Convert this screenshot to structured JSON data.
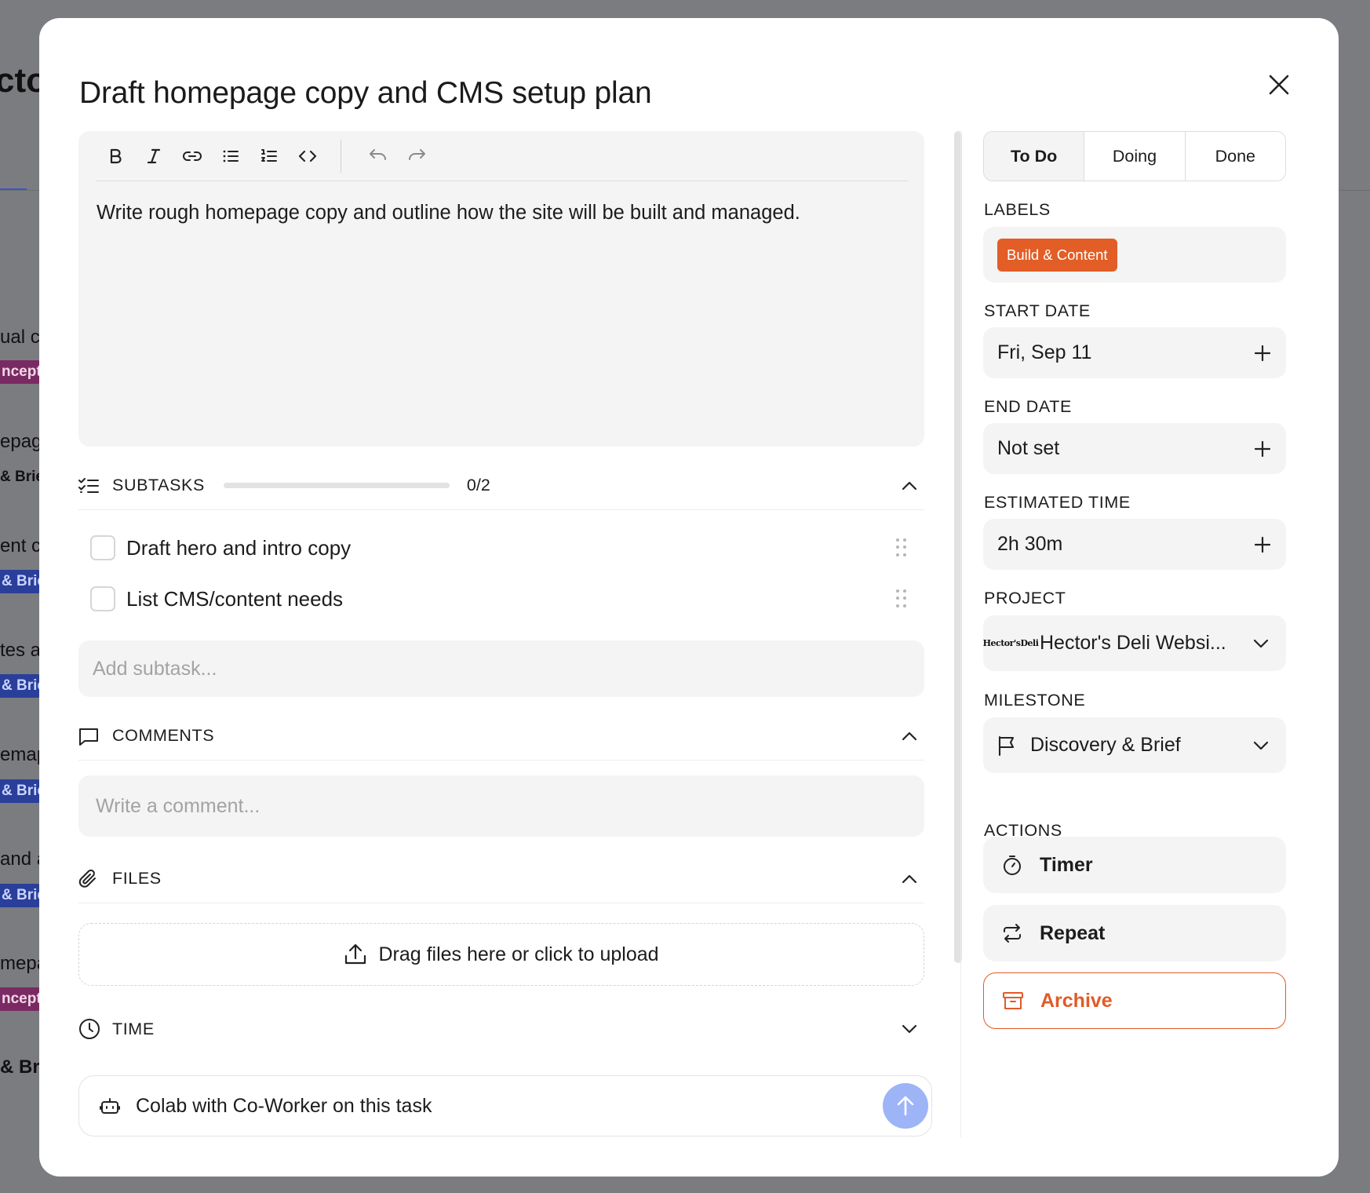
{
  "background": {
    "title_fragment": "cto",
    "items": [
      {
        "text": "ual c",
        "tag": "ncepts",
        "tag_color": "pink"
      },
      {
        "text": "epag",
        "tag": "& Brie",
        "tag_color": "plain"
      },
      {
        "text": "ent c",
        "tag": "& Brie",
        "tag_color": "blue"
      },
      {
        "text": "tes a",
        "tag": "& Brie",
        "tag_color": "blue"
      },
      {
        "text": "emap",
        "tag": "& Brie",
        "tag_color": "blue"
      },
      {
        "text": "and a",
        "tag": "& Brie",
        "tag_color": "blue"
      },
      {
        "text": "mepa",
        "tag": "ncepts",
        "tag_color": "pink"
      },
      {
        "text": "& Br",
        "tag": "",
        "tag_color": ""
      }
    ]
  },
  "modal": {
    "title": "Draft homepage copy and CMS setup plan",
    "description": "Write rough homepage copy and outline how the site will be built and managed."
  },
  "toolbar": {
    "buttons": [
      "bold-icon",
      "italic-icon",
      "link-icon",
      "bullet-list-icon",
      "numbered-list-icon",
      "code-icon",
      "undo-icon",
      "redo-icon"
    ]
  },
  "subtasks": {
    "label": "SUBTASKS",
    "count": "0/2",
    "progress": 0,
    "items": [
      {
        "label": "Draft hero and intro copy",
        "checked": false
      },
      {
        "label": "List CMS/content needs",
        "checked": false
      }
    ],
    "add_placeholder": "Add subtask..."
  },
  "comments": {
    "label": "COMMENTS",
    "placeholder": "Write a comment..."
  },
  "files": {
    "label": "FILES",
    "upload_label": "Drag files here or click to upload"
  },
  "time": {
    "label": "TIME"
  },
  "colab": {
    "label": "Colab with Co-Worker on this task"
  },
  "status": {
    "options": [
      "To Do",
      "Doing",
      "Done"
    ],
    "selected": "To Do"
  },
  "sidebar": {
    "labels_heading": "LABELS",
    "label_chip": "Build & Content",
    "label_color": "#e35d26",
    "start_date_heading": "START DATE",
    "start_date": "Fri, Sep 11",
    "end_date_heading": "END DATE",
    "end_date": "Not set",
    "estimated_heading": "ESTIMATED TIME",
    "estimated": "2h 30m",
    "project_heading": "PROJECT",
    "project": "Hector's Deli Websi...",
    "project_logo_text": "Hector's Deli",
    "milestone_heading": "MILESTONE",
    "milestone": "Discovery & Brief",
    "actions_heading": "ACTIONS",
    "timer": "Timer",
    "repeat": "Repeat",
    "archive": "Archive",
    "archive_color": "#e25a28"
  }
}
